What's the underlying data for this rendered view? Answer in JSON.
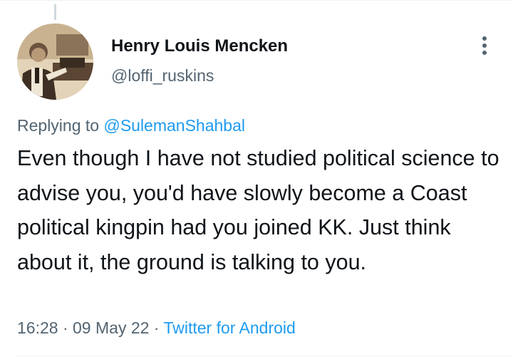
{
  "colors": {
    "text_primary": "#0f1419",
    "text_secondary": "#536471",
    "link": "#1d9bf0",
    "divider": "#eff3f4"
  },
  "author": {
    "display_name": "Henry Louis Mencken",
    "handle": "@loffi_ruskins",
    "avatar_icon": "sepia-portrait-avatar"
  },
  "more_icon": "vertical-ellipsis-icon",
  "reply": {
    "prefix": "Replying to ",
    "mention": "@SulemanShahbal"
  },
  "tweet": {
    "text": "Even though I have not studied political science to advise you, you'd have slowly become a Coast political kingpin had you joined KK. Just think about it, the ground is talking to you."
  },
  "meta": {
    "time": "16:28",
    "separator": " · ",
    "date": "09 May 22",
    "source": "Twitter for Android"
  }
}
